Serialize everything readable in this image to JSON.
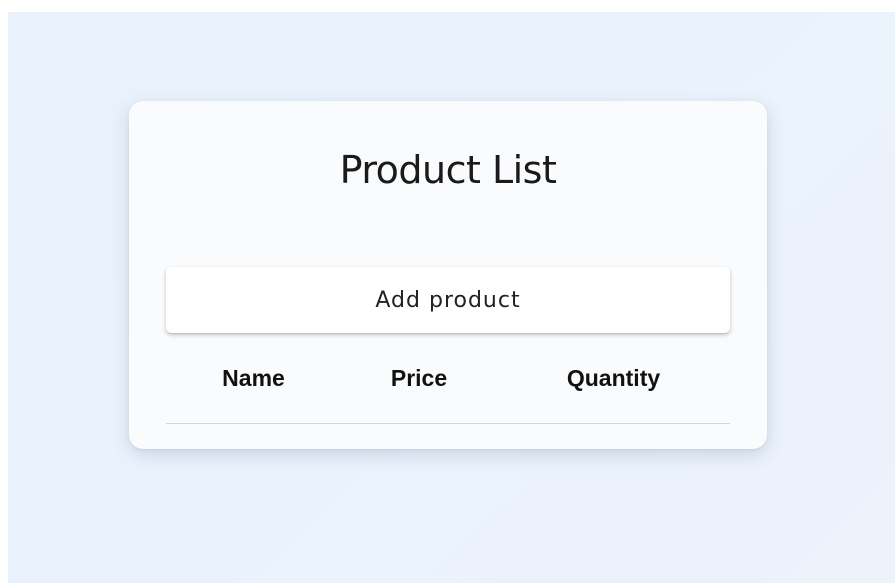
{
  "card": {
    "title": "Product List",
    "add_button_label": "Add product"
  },
  "table": {
    "columns": [
      "Name",
      "Price",
      "Quantity"
    ],
    "rows": []
  },
  "colors": {
    "background": "#eaf3fd",
    "card": "#f9fbfd",
    "button": "#ffffff",
    "text": "#1a1a1a",
    "divider": "#d3d6da"
  }
}
